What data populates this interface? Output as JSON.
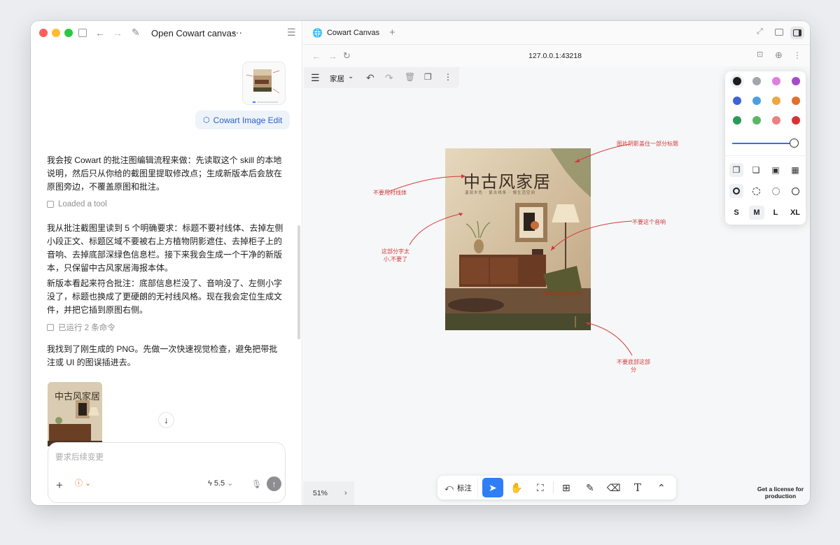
{
  "left": {
    "title": "Open Cowart canvas",
    "skill_chip": "Cowart Image Edit",
    "messages": [
      "我会按 Cowart 的批注图编辑流程来做：先读取这个 skill 的本地说明，然后只从你给的截图里提取修改点；生成新版本后会放在原图旁边，不覆盖原图和批注。",
      "我从批注截图里读到 5 个明确要求：标题不要衬线体、去掉左侧小段正文、标题区域不要被右上方植物阴影遮住、去掉柜子上的音响、去掉底部深绿色信息栏。接下来我会生成一个干净的新版本，只保留中古风家居海报本体。",
      "新版本看起来符合批注：底部信息栏没了、音响没了、左侧小字没了，标题也换成了更硬朗的无衬线风格。现在我会定位生成文件，并把它插到原图右侧。",
      "我找到了刚生成的 PNG。先做一次快速视觉检查，避免把带批注或 UI 的图误插进去。"
    ],
    "meta_1": "Loaded a tool",
    "meta_2": "已运行 2 条命令",
    "poster_title": "中古风家居",
    "composer_placeholder": "要求后续变更",
    "model": "5.5"
  },
  "right": {
    "tab_title": "Cowart Canvas",
    "url": "127.0.0.1:43218",
    "canvas_toolbar_label": "家居",
    "zoom": "51%",
    "license": "Get a license for production",
    "bottom_label": "标注",
    "sizes": [
      "S",
      "M",
      "L",
      "XL"
    ],
    "poster": {
      "title": "中古风家居",
      "subtitle": "温润木色 · 复古线条 · 慢生活空间"
    },
    "annotations": [
      "图片阴影盖住一部分标题",
      "不要用衬线体",
      "不要这个音响",
      "这部分字太小,不要了",
      "不要底部这部分"
    ]
  },
  "colors": {
    "accent": "#2f7ef6",
    "annotation": "#d23b3b",
    "palette": [
      "#1d1d1f",
      "#a3a6ac",
      "#e07fe3",
      "#a64ac9",
      "#3f63d8",
      "#4aa0e6",
      "#efa740",
      "#e0702a",
      "#2a9a56",
      "#58b865",
      "#ee7f82",
      "#d83333"
    ]
  }
}
